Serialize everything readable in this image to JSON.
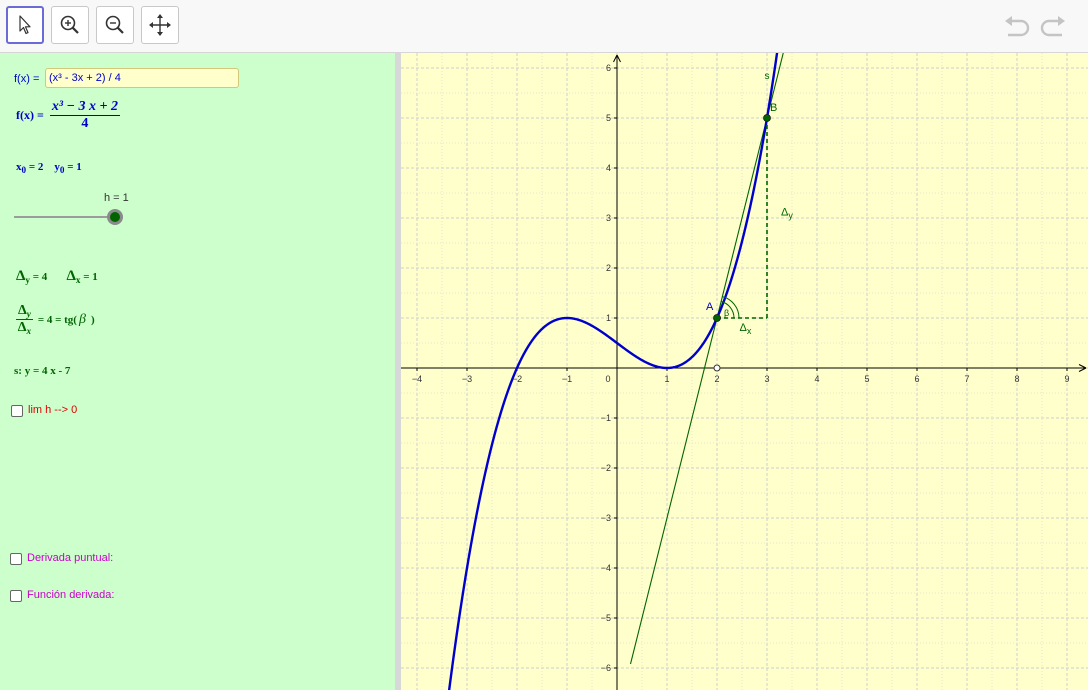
{
  "toolbar": {
    "tools": [
      "move-tool",
      "zoom-in-tool",
      "zoom-out-tool",
      "move-graphics-tool"
    ],
    "actions": [
      "undo",
      "redo"
    ]
  },
  "algebra": {
    "input_label": "f(x) =",
    "input_value": "(x³ - 3x + 2) / 4",
    "f_label": "f(x) =",
    "f_numerator": "x³ − 3 x + 2",
    "f_denominator": "4",
    "x0_label": "x",
    "x0_sub": "0",
    "x0_value": "= 2",
    "y0_label": "y",
    "y0_sub": "0",
    "y0_value": "= 1",
    "slider_label": "h = 1",
    "slider_value": 1,
    "delta": "Δ",
    "delta_y_sub": "y",
    "delta_y_value": "= 4",
    "delta_x_sub": "x",
    "delta_x_value": "= 1",
    "ratio_num_sub": "y",
    "ratio_den_sub": "x",
    "ratio_result": "= 4 = tg(",
    "ratio_beta": "β",
    "ratio_close": ")",
    "secant_eq": "s: y = 4 x - 7",
    "lim_label": "lim h --> 0",
    "derivada_label": "Derivada puntual:",
    "funcion_label": "Función derivada:",
    "colors": {
      "lim": "#e00000",
      "derivada": "#cc00cc",
      "funcion": "#cc00cc"
    }
  },
  "chart_data": {
    "type": "line",
    "xlim": [
      -4.3,
      9.4
    ],
    "ylim": [
      -6.4,
      6.3
    ],
    "x_ticks": [
      "−4",
      "−3",
      "−2",
      "−1",
      "0",
      "1",
      "2",
      "3",
      "4",
      "5",
      "6",
      "7",
      "8",
      "9"
    ],
    "y_ticks": [
      "6",
      "5",
      "4",
      "3",
      "2",
      "1",
      "−1",
      "−2",
      "−3",
      "−4",
      "−5",
      "−6"
    ],
    "x_tick_values": [
      -4,
      -3,
      -2,
      -1,
      0,
      1,
      2,
      3,
      4,
      5,
      6,
      7,
      8,
      9
    ],
    "y_tick_values": [
      6,
      5,
      4,
      3,
      2,
      1,
      -1,
      -2,
      -3,
      -4,
      -5,
      -6
    ],
    "grid": true,
    "curve": "f(x) = (x³ − 3x + 2) / 4",
    "secant": "s: y = 4x − 7",
    "point_A": {
      "label": "A",
      "x": 2,
      "y": 1
    },
    "point_B": {
      "label": "B",
      "x": 3,
      "y": 5
    },
    "open_point": {
      "x": 2,
      "y": 0
    },
    "secant_label": "s",
    "angle_label": "β",
    "delta_y_label": "Δ",
    "delta_y_sub": "y",
    "delta_x_label": "Δ",
    "delta_x_sub": "x",
    "colors": {
      "curve": "#0000cc",
      "secant": "#006400",
      "points": "#006400",
      "axis": "#000000",
      "grid": "#d4d4d4"
    }
  }
}
